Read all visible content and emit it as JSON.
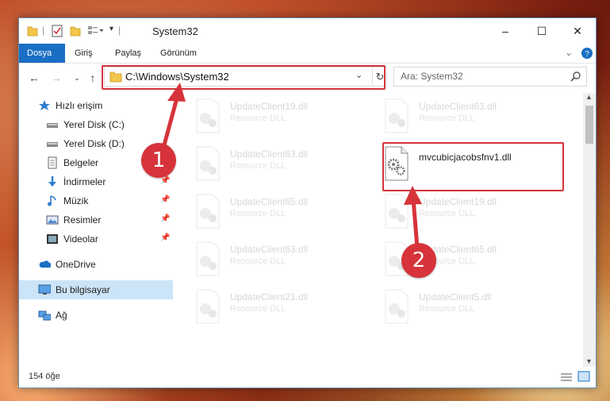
{
  "window": {
    "title": "System32",
    "controls": {
      "minimize": "–",
      "maximize": "☐",
      "close": "✕"
    }
  },
  "ribbon": {
    "tabs": [
      {
        "label": "Dosya",
        "active": true
      },
      {
        "label": "Giriş"
      },
      {
        "label": "Paylaş"
      },
      {
        "label": "Görünüm"
      }
    ]
  },
  "address": {
    "path": "C:\\Windows\\System32"
  },
  "search": {
    "placeholder": "Ara: System32"
  },
  "sidebar": {
    "items": [
      {
        "label": "Hızlı erişim",
        "icon": "star-icon"
      },
      {
        "label": "Yerel Disk (C:)",
        "icon": "drive-icon"
      },
      {
        "label": "Yerel Disk (D:)",
        "icon": "drive-icon"
      },
      {
        "label": "Belgeler",
        "icon": "documents-icon"
      },
      {
        "label": "İndirmeler",
        "icon": "download-icon",
        "pinned": true
      },
      {
        "label": "Müzik",
        "icon": "music-icon",
        "pinned": true
      },
      {
        "label": "Resimler",
        "icon": "pictures-icon",
        "pinned": true
      },
      {
        "label": "Videolar",
        "icon": "videos-icon",
        "pinned": true
      },
      {
        "label": "OneDrive",
        "icon": "cloud-icon"
      },
      {
        "label": "Bu bilgisayar",
        "icon": "computer-icon",
        "selected": true
      },
      {
        "label": "Ağ",
        "icon": "network-icon"
      }
    ]
  },
  "files": {
    "left_column": [
      {
        "name": "UpdateClient19.dll",
        "type": "Resource DLL"
      },
      {
        "name": "UpdateClient63.dll",
        "type": "Resource DLL"
      },
      {
        "name": "UpdateClient65.dll",
        "type": "Resource DLL"
      },
      {
        "name": "UpdateClient63.dll",
        "type": "Resource DLL"
      },
      {
        "name": "UpdateClient21.dll",
        "type": "Resource DLL"
      }
    ],
    "right_column": [
      {
        "name": "UpdateClient63.dll",
        "type": "Resource DLL"
      },
      {
        "name": "mvcubicjacobsfnv1.dll",
        "type": "",
        "highlighted": true
      },
      {
        "name": "UpdateClient19.dll",
        "type": "Resource DLL"
      },
      {
        "name": "UpdateClient65.dll",
        "type": "Resource DLL"
      },
      {
        "name": "UpdateClient5.dll",
        "type": "Resource DLL"
      }
    ]
  },
  "status": {
    "item_count": "154 öğe"
  },
  "callouts": {
    "one": "1",
    "two": "2"
  },
  "colors": {
    "accent": "#1a6fc4",
    "highlight": "#d6333a",
    "selected": "#cce4f7"
  }
}
